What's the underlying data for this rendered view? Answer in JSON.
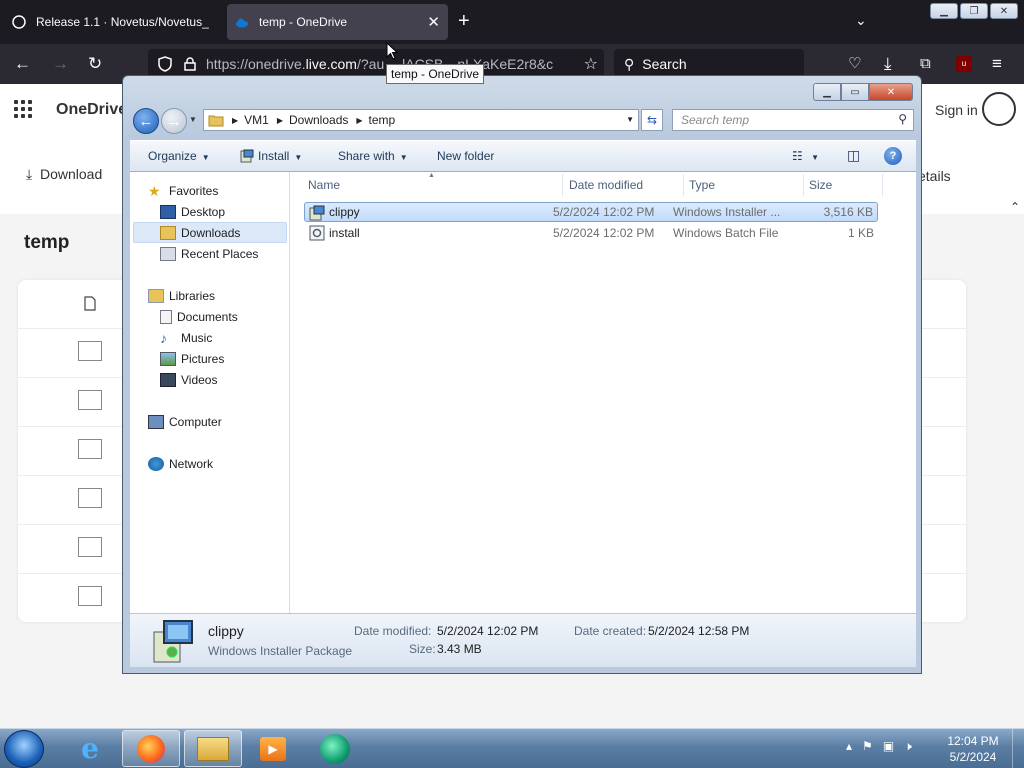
{
  "browser": {
    "tabs": [
      {
        "title": "Release 1.1 · Novetus/Novetus_",
        "active": false
      },
      {
        "title": "temp - OneDrive",
        "active": true
      }
    ],
    "url_prefix": "https://onedrive.",
    "url_domain": "live.com",
    "url_rest": "/?au…      lACSB…nLXaKeE2r8&c",
    "search_placeholder": "Search",
    "tooltip": "temp - OneDrive"
  },
  "onedrive": {
    "app_name": "OneDrive",
    "sign_in": "Sign in",
    "download": "Download",
    "details": "etails",
    "folder_title": "temp"
  },
  "explorer": {
    "breadcrumb": [
      "VM1",
      "Downloads",
      "temp"
    ],
    "search_placeholder": "Search temp",
    "toolbar": {
      "organize": "Organize",
      "install": "Install",
      "share_with": "Share with",
      "new_folder": "New folder"
    },
    "nav": {
      "favorites": "Favorites",
      "desktop": "Desktop",
      "downloads": "Downloads",
      "recent_places": "Recent Places",
      "libraries": "Libraries",
      "documents": "Documents",
      "music": "Music",
      "pictures": "Pictures",
      "videos": "Videos",
      "computer": "Computer",
      "network": "Network"
    },
    "columns": {
      "name": "Name",
      "date_modified": "Date modified",
      "type": "Type",
      "size": "Size"
    },
    "files": [
      {
        "name": "clippy",
        "date": "5/2/2024 12:02 PM",
        "type": "Windows Installer ...",
        "size": "3,516 KB",
        "selected": true
      },
      {
        "name": "install",
        "date": "5/2/2024 12:02 PM",
        "type": "Windows Batch File",
        "size": "1 KB",
        "selected": false
      }
    ],
    "details": {
      "name": "clippy",
      "type": "Windows Installer Package",
      "date_modified_label": "Date modified:",
      "date_modified": "5/2/2024 12:02 PM",
      "size_label": "Size:",
      "size": "3.43 MB",
      "date_created_label": "Date created:",
      "date_created": "5/2/2024 12:58 PM"
    }
  },
  "taskbar": {
    "time": "12:04 PM",
    "date": "5/2/2024"
  },
  "colors": {
    "ff_tabbar": "#1c1b22",
    "ff_nav": "#2b2a33",
    "selection": "#c1dbfc",
    "taskbar": "#5b7ea4"
  }
}
